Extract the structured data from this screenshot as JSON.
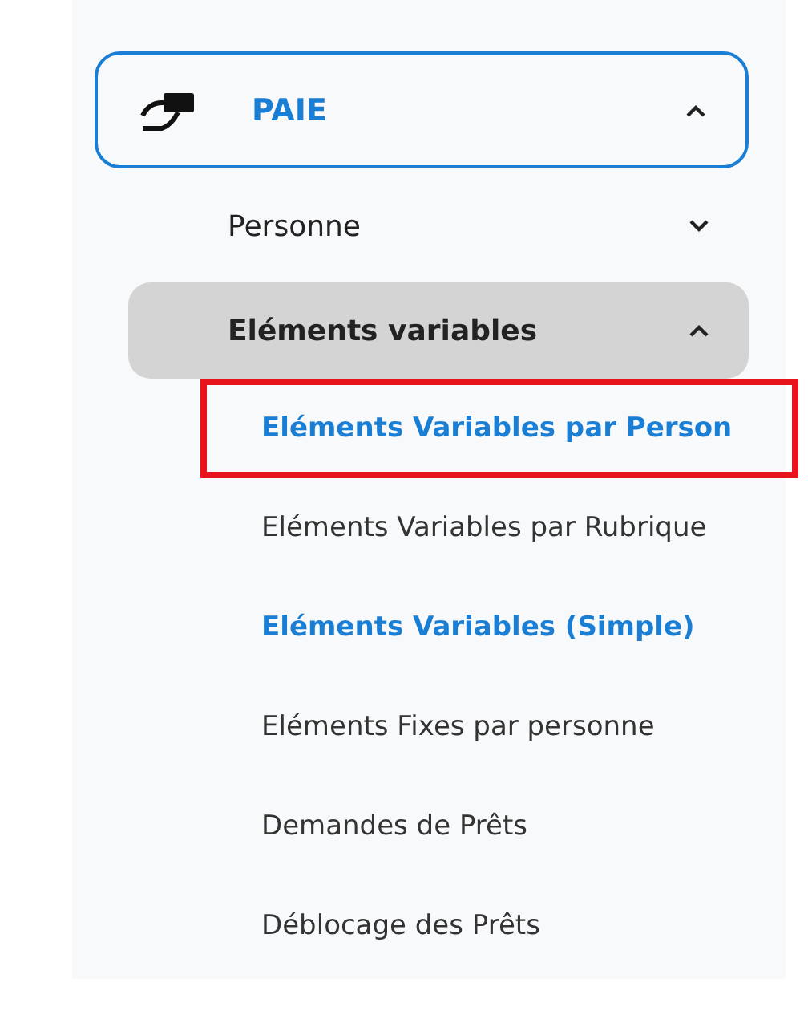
{
  "menu": {
    "label": "PAIE",
    "expanded": true,
    "groups": [
      {
        "label": "Personne",
        "expanded": false,
        "selected": false
      },
      {
        "label": "Eléments variables",
        "expanded": true,
        "selected": true,
        "children": [
          {
            "label": "Eléments Variables par Person",
            "active": true,
            "highlighted": true
          },
          {
            "label": "Eléments Variables par Rubrique",
            "active": false,
            "highlighted": false
          },
          {
            "label": "Eléments Variables (Simple)",
            "active": true,
            "highlighted": false
          },
          {
            "label": "Eléments Fixes par personne",
            "active": false,
            "highlighted": false
          },
          {
            "label": "Demandes de Prêts",
            "active": false,
            "highlighted": false
          },
          {
            "label": "Déblocage des Prêts",
            "active": false,
            "highlighted": false
          }
        ]
      }
    ]
  }
}
